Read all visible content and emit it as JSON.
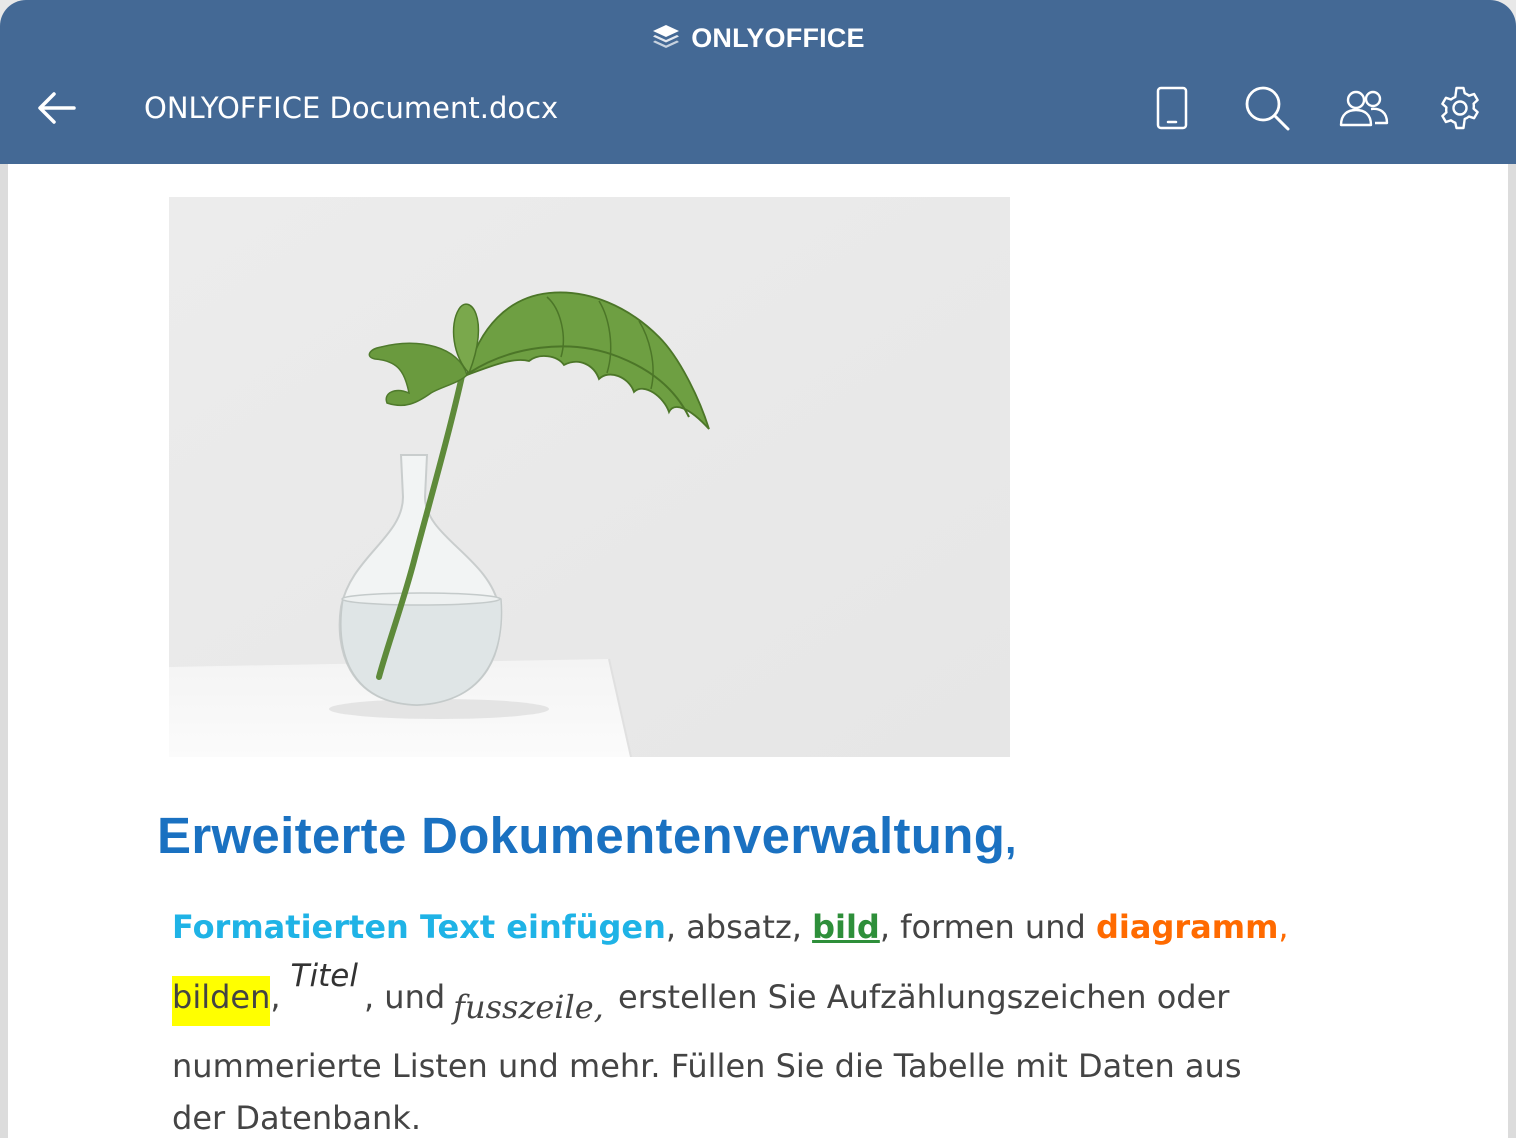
{
  "header": {
    "brand": "ONLYOFFICE",
    "document_title": "ONLYOFFICE Document.docx",
    "icons": {
      "back": "arrow-left-icon",
      "brand_logo": "layers-logo-icon",
      "mobile_view": "mobile-icon",
      "search": "search-icon",
      "users": "users-icon",
      "settings": "gear-icon"
    },
    "colors": {
      "background": "#446995",
      "foreground": "#ffffff"
    }
  },
  "document": {
    "image_subject": "plant-in-glass-vase",
    "heading": "Erweiterte Dokumentenverwaltung",
    "heading_punct": ",",
    "paragraph": {
      "format_text": "Formatierten Text einfügen",
      "sep1": ",  absatz, ",
      "bild": "bild",
      "sep2": ", formen und ",
      "diagramm": "diagramm",
      "comma": ",",
      "bilden": "bilden",
      "comma2": ",",
      "titel": "Titel",
      "und": ", und",
      "fusszeile": "fusszeile,",
      "rest_line2": "erstellen Sie Aufzählungszeichen oder",
      "line3": "nummerierte Listen und mehr. Füllen Sie die Tabelle mit Daten aus",
      "line4": "der Datenbank."
    },
    "colors": {
      "heading": "#1a71c1",
      "format_text": "#1fb3e6",
      "bild": "#2e8f3a",
      "diagramm": "#ff6a00",
      "highlight": "#ffff00",
      "body": "#444444"
    }
  }
}
